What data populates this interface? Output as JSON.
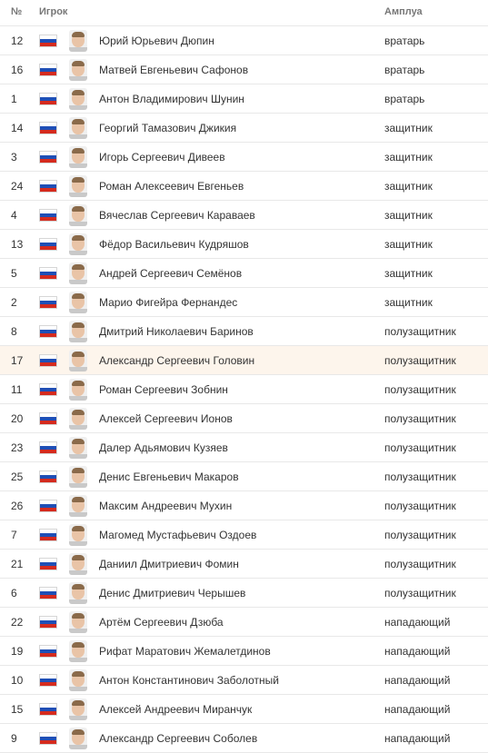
{
  "header": {
    "number_label": "№",
    "player_label": "Игрок",
    "role_label": "Амплуа"
  },
  "colors": {
    "row_highlight": "#fdf5ec",
    "divider": "#e8e8e8",
    "flag_white": "#ffffff",
    "flag_blue": "#1f4fb6",
    "flag_red": "#d52b1e"
  },
  "rows": [
    {
      "number": "12",
      "name": "Юрий Юрьевич Дюпин",
      "role": "вратарь",
      "flag": "russia-flag-icon",
      "highlighted": false
    },
    {
      "number": "16",
      "name": "Матвей Евгеньевич Сафонов",
      "role": "вратарь",
      "flag": "russia-flag-icon",
      "highlighted": false
    },
    {
      "number": "1",
      "name": "Антон Владимирович Шунин",
      "role": "вратарь",
      "flag": "russia-flag-icon",
      "highlighted": false
    },
    {
      "number": "14",
      "name": "Георгий Тамазович Джикия",
      "role": "защитник",
      "flag": "russia-flag-icon",
      "highlighted": false
    },
    {
      "number": "3",
      "name": "Игорь Сергеевич Дивеев",
      "role": "защитник",
      "flag": "russia-flag-icon",
      "highlighted": false
    },
    {
      "number": "24",
      "name": "Роман Алексеевич Евгеньев",
      "role": "защитник",
      "flag": "russia-flag-icon",
      "highlighted": false
    },
    {
      "number": "4",
      "name": "Вячеслав Сергеевич Караваев",
      "role": "защитник",
      "flag": "russia-flag-icon",
      "highlighted": false
    },
    {
      "number": "13",
      "name": "Фёдор Васильевич Кудряшов",
      "role": "защитник",
      "flag": "russia-flag-icon",
      "highlighted": false
    },
    {
      "number": "5",
      "name": "Андрей Сергеевич Семёнов",
      "role": "защитник",
      "flag": "russia-flag-icon",
      "highlighted": false
    },
    {
      "number": "2",
      "name": "Марио Фигейра Фернандес",
      "role": "защитник",
      "flag": "russia-flag-icon",
      "highlighted": false
    },
    {
      "number": "8",
      "name": "Дмитрий Николаевич Баринов",
      "role": "полузащитник",
      "flag": "russia-flag-icon",
      "highlighted": false
    },
    {
      "number": "17",
      "name": "Александр Сергеевич Головин",
      "role": "полузащитник",
      "flag": "russia-flag-icon",
      "highlighted": true
    },
    {
      "number": "11",
      "name": "Роман Сергеевич Зобнин",
      "role": "полузащитник",
      "flag": "russia-flag-icon",
      "highlighted": false
    },
    {
      "number": "20",
      "name": "Алексей Сергеевич Ионов",
      "role": "полузащитник",
      "flag": "russia-flag-icon",
      "highlighted": false
    },
    {
      "number": "23",
      "name": "Далер Адьямович Кузяев",
      "role": "полузащитник",
      "flag": "russia-flag-icon",
      "highlighted": false
    },
    {
      "number": "25",
      "name": "Денис Евгеньевич Макаров",
      "role": "полузащитник",
      "flag": "russia-flag-icon",
      "highlighted": false
    },
    {
      "number": "26",
      "name": "Максим Андреевич Мухин",
      "role": "полузащитник",
      "flag": "russia-flag-icon",
      "highlighted": false
    },
    {
      "number": "7",
      "name": "Магомед Мустафьевич Оздоев",
      "role": "полузащитник",
      "flag": "russia-flag-icon",
      "highlighted": false
    },
    {
      "number": "21",
      "name": "Даниил Дмитриевич Фомин",
      "role": "полузащитник",
      "flag": "russia-flag-icon",
      "highlighted": false
    },
    {
      "number": "6",
      "name": "Денис Дмитриевич Черышев",
      "role": "полузащитник",
      "flag": "russia-flag-icon",
      "highlighted": false
    },
    {
      "number": "22",
      "name": "Артём Сергеевич Дзюба",
      "role": "нападающий",
      "flag": "russia-flag-icon",
      "highlighted": false
    },
    {
      "number": "19",
      "name": "Рифат Маратович Жемалетдинов",
      "role": "нападающий",
      "flag": "russia-flag-icon",
      "highlighted": false
    },
    {
      "number": "10",
      "name": "Антон Константинович Заболотный",
      "role": "нападающий",
      "flag": "russia-flag-icon",
      "highlighted": false
    },
    {
      "number": "15",
      "name": "Алексей Андреевич Миранчук",
      "role": "нападающий",
      "flag": "russia-flag-icon",
      "highlighted": false
    },
    {
      "number": "9",
      "name": "Александр Сергеевич Соболев",
      "role": "нападающий",
      "flag": "russia-flag-icon",
      "highlighted": false
    }
  ]
}
